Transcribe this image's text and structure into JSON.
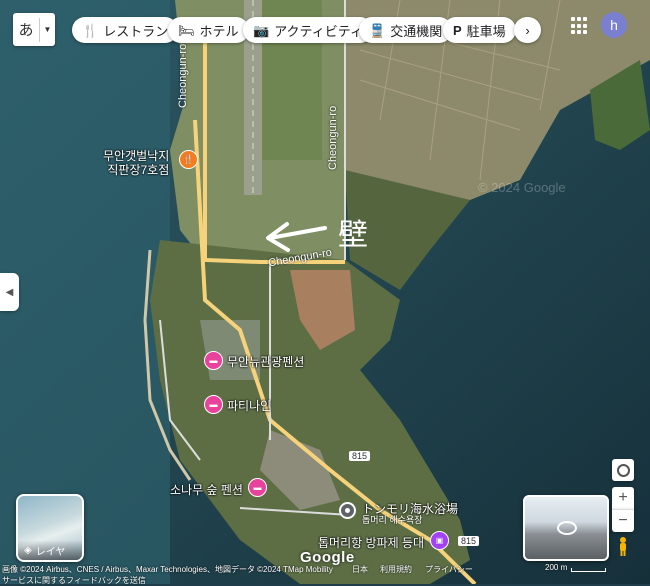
{
  "language_button": {
    "label": "あ"
  },
  "category_chips": [
    {
      "label": "レストラン",
      "icon": "restaurant-icon"
    },
    {
      "label": "ホテル",
      "icon": "hotel-icon"
    },
    {
      "label": "アクティビティ",
      "icon": "camera-icon"
    },
    {
      "label": "交通機関",
      "icon": "train-icon"
    },
    {
      "label": "駐車場",
      "icon": "parking-icon"
    }
  ],
  "more_chips_icon": "chevron-right-icon",
  "user": {
    "avatar_initial": "h",
    "avatar_color": "#7b7fd0"
  },
  "map": {
    "annotation": "壁",
    "roads": [
      {
        "name": "Cheongun-ro"
      },
      {
        "name": "Cheongun-ro"
      },
      {
        "name": "Cheongun-ro"
      },
      {
        "name": "815"
      },
      {
        "name": "815"
      }
    ],
    "places": [
      {
        "name_line1": "무안갯벌낙지",
        "name_line2": "직판장7호점",
        "type": "restaurant",
        "color": "#f47c20"
      },
      {
        "name": "무안뉴관광펜션",
        "type": "hotel",
        "color": "#e8429c"
      },
      {
        "name": "파티나인",
        "type": "hotel",
        "color": "#e8429c"
      },
      {
        "name": "소나무 숲 펜션",
        "type": "hotel",
        "color": "#e8429c"
      },
      {
        "name": "トンモリ海水浴場",
        "subname": "톱머리 해수욕장",
        "type": "beach",
        "color": "#5f6368"
      },
      {
        "name": "톱머리항 방파제 등대",
        "type": "attraction",
        "color": "#a142f4"
      }
    ],
    "watermark": "© 2024 Google"
  },
  "layer_button": {
    "label": "レイヤ"
  },
  "brand": "Google",
  "footer": {
    "attribution": "画像 ©2024 Airbus、CNES / Airbus、Maxar Technologies、地図データ ©2024 TMap Mobility",
    "links": [
      "日本",
      "利用規約",
      "プライバシー"
    ],
    "feedback": "サービスに関するフィードバックを送信",
    "scale": "200 m"
  },
  "colors": {
    "water": "#1f3d4a",
    "land": "#6b7a55",
    "road": "#f6d37a"
  }
}
